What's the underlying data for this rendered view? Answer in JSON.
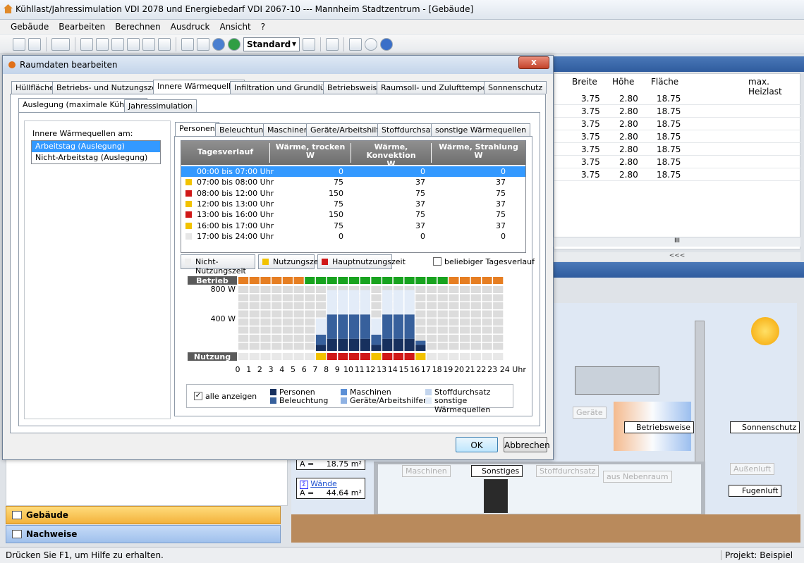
{
  "window": {
    "title": "Kühllast/Jahressimulation VDI 2078 und Energiebedarf VDI 2067-10 --- Mannheim Stadtzentrum - [Gebäude]"
  },
  "menu": [
    "Gebäude",
    "Bearbeiten",
    "Berechnen",
    "Ausdruck",
    "Ansicht",
    "?"
  ],
  "toolbar": {
    "style_select": "Standard"
  },
  "background": {
    "table_headers": [
      "Breite",
      "Höhe",
      "Fläche",
      "max. Heizlast"
    ],
    "table_rows": [
      [
        "3.75",
        "2.80",
        "18.75"
      ],
      [
        "3.75",
        "2.80",
        "18.75"
      ],
      [
        "3.75",
        "2.80",
        "18.75"
      ],
      [
        "3.75",
        "2.80",
        "18.75"
      ],
      [
        "3.75",
        "2.80",
        "18.75"
      ],
      [
        "3.75",
        "2.80",
        "18.75"
      ],
      [
        "3.75",
        "2.80",
        "18.75"
      ]
    ],
    "scroll_glyph": "III",
    "splitter_glyph": "<<<",
    "scene_labels": {
      "geraete": "Geräte",
      "betriebsweise": "Betriebsweise",
      "sonnenschutz": "Sonnenschutz",
      "maschinen": "Maschinen",
      "sonstiges": "Sonstiges",
      "stoffdurchsatz": "Stoffdurchsatz",
      "aus_nebenraum": "aus Nebenraum",
      "aussenluft": "Außenluft",
      "fugenluft": "Fugenluft",
      "a_label": "A =",
      "a_value1": "18.75 m²",
      "waende": "Wände",
      "a_value2": "44.64 m²"
    },
    "nav": {
      "gebaeude": "Gebäude",
      "nachweise": "Nachweise"
    }
  },
  "status": {
    "help": "Drücken Sie F1, um Hilfe zu erhalten.",
    "project": "Projekt: Beispiel"
  },
  "dialog": {
    "title": "Raumdaten bearbeiten",
    "close": "x",
    "tabs": [
      "Hüllfläche",
      "Betriebs- und Nutzungszeiten",
      "Innere Wärmequellen",
      "Infiltration und Grundlüftung",
      "Betriebsweise",
      "Raumsoll- und Zulufttemperatur",
      "Sonnenschutz"
    ],
    "subtabs": [
      "Auslegung (maximale Kühllast)",
      "Jahressimulation"
    ],
    "list_label": "Innere Wärmequellen am:",
    "list_items": [
      "Arbeitstag (Auslegung)",
      "Nicht-Arbeitstag (Auslegung)"
    ],
    "source_tabs": [
      "Personen",
      "Beleuchtung",
      "Maschinen",
      "Geräte/Arbeitshilfen",
      "Stoffdurchsatz",
      "sonstige Wärmequellen"
    ],
    "table": {
      "headers": [
        [
          "Tagesverlauf",
          ""
        ],
        [
          "Wärme, trocken",
          "W"
        ],
        [
          "Wärme, Konvektion",
          "W"
        ],
        [
          "Wärme, Strahlung",
          "W"
        ]
      ],
      "rows": [
        {
          "zeit": "00:00 bis 07:00 Uhr",
          "trocken": "0",
          "konv": "0",
          "strahl": "0",
          "color": "#3399ff"
        },
        {
          "zeit": "07:00 bis 08:00 Uhr",
          "trocken": "75",
          "konv": "37",
          "strahl": "37",
          "color": "#f2c200"
        },
        {
          "zeit": "08:00 bis 12:00 Uhr",
          "trocken": "150",
          "konv": "75",
          "strahl": "75",
          "color": "#d01818"
        },
        {
          "zeit": "12:00 bis 13:00 Uhr",
          "trocken": "75",
          "konv": "37",
          "strahl": "37",
          "color": "#f2c200"
        },
        {
          "zeit": "13:00 bis 16:00 Uhr",
          "trocken": "150",
          "konv": "75",
          "strahl": "75",
          "color": "#d01818"
        },
        {
          "zeit": "16:00 bis 17:00 Uhr",
          "trocken": "75",
          "konv": "37",
          "strahl": "37",
          "color": "#f2c200"
        },
        {
          "zeit": "17:00 bis 24:00 Uhr",
          "trocken": "0",
          "konv": "0",
          "strahl": "0",
          "color": "#e6e6e6"
        }
      ]
    },
    "legend_buttons": [
      {
        "label": "Nicht-Nutzungszeit",
        "color": "#eeeeee"
      },
      {
        "label": "Nutzungszeit",
        "color": "#f2c200"
      },
      {
        "label": "Hauptnutzungszeit",
        "color": "#d01818"
      }
    ],
    "custom_profile": "beliebiger Tagesverlauf",
    "show_all": "alle anzeigen",
    "chart_legend": [
      {
        "label": "Personen",
        "color": "#17305e"
      },
      {
        "label": "Beleuchtung",
        "color": "#37609c"
      },
      {
        "label": "Maschinen",
        "color": "#5b8fd6"
      },
      {
        "label": "Geräte/Arbeitshilfen",
        "color": "#8fb2e3"
      },
      {
        "label": "Stoffdurchsatz",
        "color": "#c3d5ee"
      },
      {
        "label": "sonstige Wärmequellen",
        "color": "#e3ecf8"
      }
    ],
    "ok": "OK",
    "cancel": "Abbrechen"
  },
  "chart_data": {
    "type": "bar",
    "row_labels": {
      "top": "Betrieb",
      "bottom": "Nutzung"
    },
    "y_ticks": [
      "800 W",
      "400 W"
    ],
    "ylim": [
      0,
      800
    ],
    "x": [
      "0",
      "1",
      "2",
      "3",
      "4",
      "5",
      "6",
      "7",
      "8",
      "9",
      "10",
      "11",
      "12",
      "13",
      "14",
      "15",
      "16",
      "17",
      "18",
      "19",
      "20",
      "21",
      "22",
      "23",
      "24 Uhr"
    ],
    "betrieb": [
      "orange",
      "orange",
      "orange",
      "orange",
      "orange",
      "orange",
      "green",
      "green",
      "green",
      "green",
      "green",
      "green",
      "green",
      "green",
      "green",
      "green",
      "green",
      "green",
      "green",
      "orange",
      "orange",
      "orange",
      "orange",
      "orange"
    ],
    "nutzung": [
      "none",
      "none",
      "none",
      "none",
      "none",
      "none",
      "none",
      "yellow",
      "red",
      "red",
      "red",
      "red",
      "yellow",
      "red",
      "red",
      "red",
      "yellow",
      "none",
      "none",
      "none",
      "none",
      "none",
      "none",
      "none"
    ],
    "series": [
      {
        "name": "Personen",
        "values": [
          0,
          0,
          0,
          0,
          0,
          0,
          0,
          75,
          150,
          150,
          150,
          150,
          75,
          150,
          150,
          150,
          75,
          0,
          0,
          0,
          0,
          0,
          0,
          0
        ]
      },
      {
        "name": "Beleuchtung",
        "values": [
          0,
          0,
          0,
          0,
          0,
          0,
          0,
          125,
          300,
          300,
          300,
          300,
          125,
          300,
          300,
          300,
          50,
          0,
          0,
          0,
          0,
          0,
          0,
          0
        ]
      },
      {
        "name": "sonstige Wärmequellen",
        "values": [
          0,
          0,
          0,
          0,
          0,
          0,
          0,
          200,
          300,
          300,
          300,
          300,
          200,
          300,
          300,
          300,
          0,
          0,
          0,
          0,
          0,
          0,
          0,
          0
        ]
      }
    ]
  }
}
